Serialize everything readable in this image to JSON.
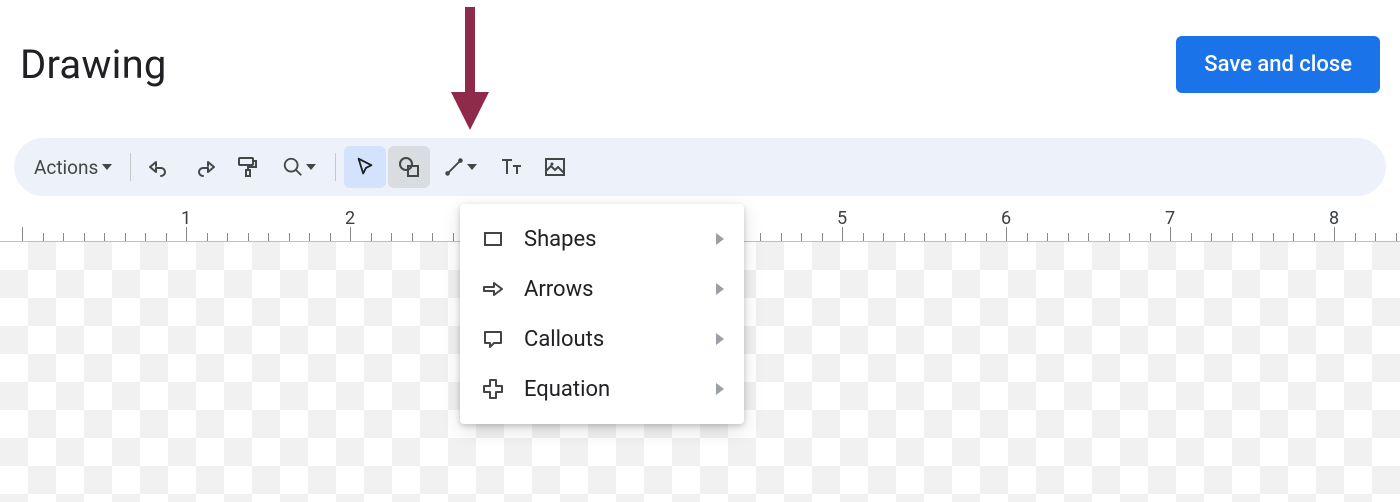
{
  "header": {
    "title": "Drawing",
    "save_label": "Save and close"
  },
  "toolbar": {
    "actions_label": "Actions"
  },
  "dropdown": {
    "items": [
      {
        "label": "Shapes",
        "icon": "rectangle-icon"
      },
      {
        "label": "Arrows",
        "icon": "arrow-right-icon"
      },
      {
        "label": "Callouts",
        "icon": "callout-icon"
      },
      {
        "label": "Equation",
        "icon": "plus-icon"
      }
    ]
  },
  "ruler": {
    "labels": [
      "1",
      "2",
      "5",
      "6",
      "7",
      "8"
    ]
  },
  "annotation": {
    "arrow_color": "#8e2b4a"
  }
}
